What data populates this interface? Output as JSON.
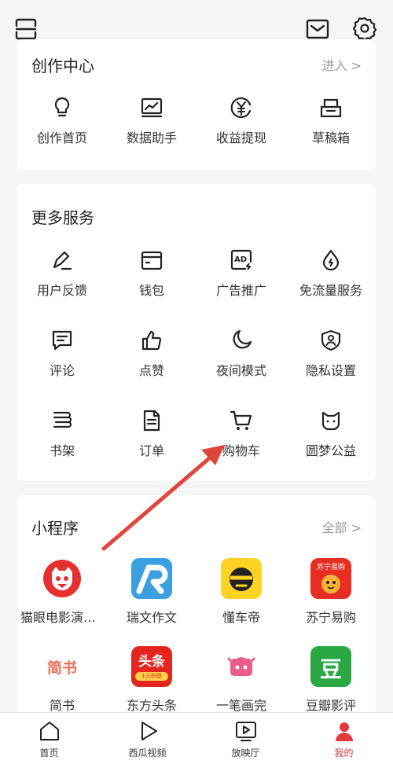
{
  "creator": {
    "title": "创作中心",
    "more": "进入 >",
    "items": [
      {
        "label": "创作首页",
        "icon": "bulb-icon"
      },
      {
        "label": "数据助手",
        "icon": "chart-icon"
      },
      {
        "label": "收益提现",
        "icon": "yuan-icon"
      },
      {
        "label": "草稿箱",
        "icon": "drafts-icon"
      }
    ]
  },
  "services": {
    "title": "更多服务",
    "items": [
      {
        "label": "用户反馈",
        "icon": "pen-icon"
      },
      {
        "label": "钱包",
        "icon": "wallet-icon"
      },
      {
        "label": "广告推广",
        "icon": "ad-icon"
      },
      {
        "label": "免流量服务",
        "icon": "drop-icon"
      },
      {
        "label": "评论",
        "icon": "comment-icon"
      },
      {
        "label": "点赞",
        "icon": "thumb-icon"
      },
      {
        "label": "夜间模式",
        "icon": "moon-icon"
      },
      {
        "label": "隐私设置",
        "icon": "shield-icon"
      },
      {
        "label": "书架",
        "icon": "book-icon"
      },
      {
        "label": "订单",
        "icon": "order-icon"
      },
      {
        "label": "购物车",
        "icon": "cart-icon"
      },
      {
        "label": "圆梦公益",
        "icon": "cat-icon"
      }
    ]
  },
  "mini": {
    "title": "小程序",
    "more": "全部 >",
    "apps": [
      {
        "label": "猫眼电影演出赛事",
        "icon": "maoyan-logo-icon"
      },
      {
        "label": "瑞文作文",
        "icon": "ruiwen-logo-icon"
      },
      {
        "label": "懂车帝",
        "icon": "dongchedi-logo-icon"
      },
      {
        "label": "苏宁易购",
        "icon": "suning-logo-icon",
        "tile_text": "苏宁易购"
      },
      {
        "label": "简书",
        "icon": "jianshu-logo-icon",
        "tile_text": "简书"
      },
      {
        "label": "东方头条",
        "icon": "dongfang-logo-icon",
        "tile_text": "头条",
        "tile_sub": "1元秒提"
      },
      {
        "label": "一笔画完",
        "icon": "yibihuawan-logo-icon"
      },
      {
        "label": "豆瓣影评",
        "icon": "douban-logo-icon",
        "tile_text": "豆"
      }
    ]
  },
  "tabbar": {
    "tabs": [
      {
        "label": "首页",
        "icon": "home-icon"
      },
      {
        "label": "西瓜视频",
        "icon": "play-icon"
      },
      {
        "label": "放映厅",
        "icon": "tv-icon"
      },
      {
        "label": "我的",
        "icon": "user-icon"
      }
    ]
  },
  "colors": {
    "accent_red": "#e03a3a",
    "arrow_red": "#e0463c"
  }
}
